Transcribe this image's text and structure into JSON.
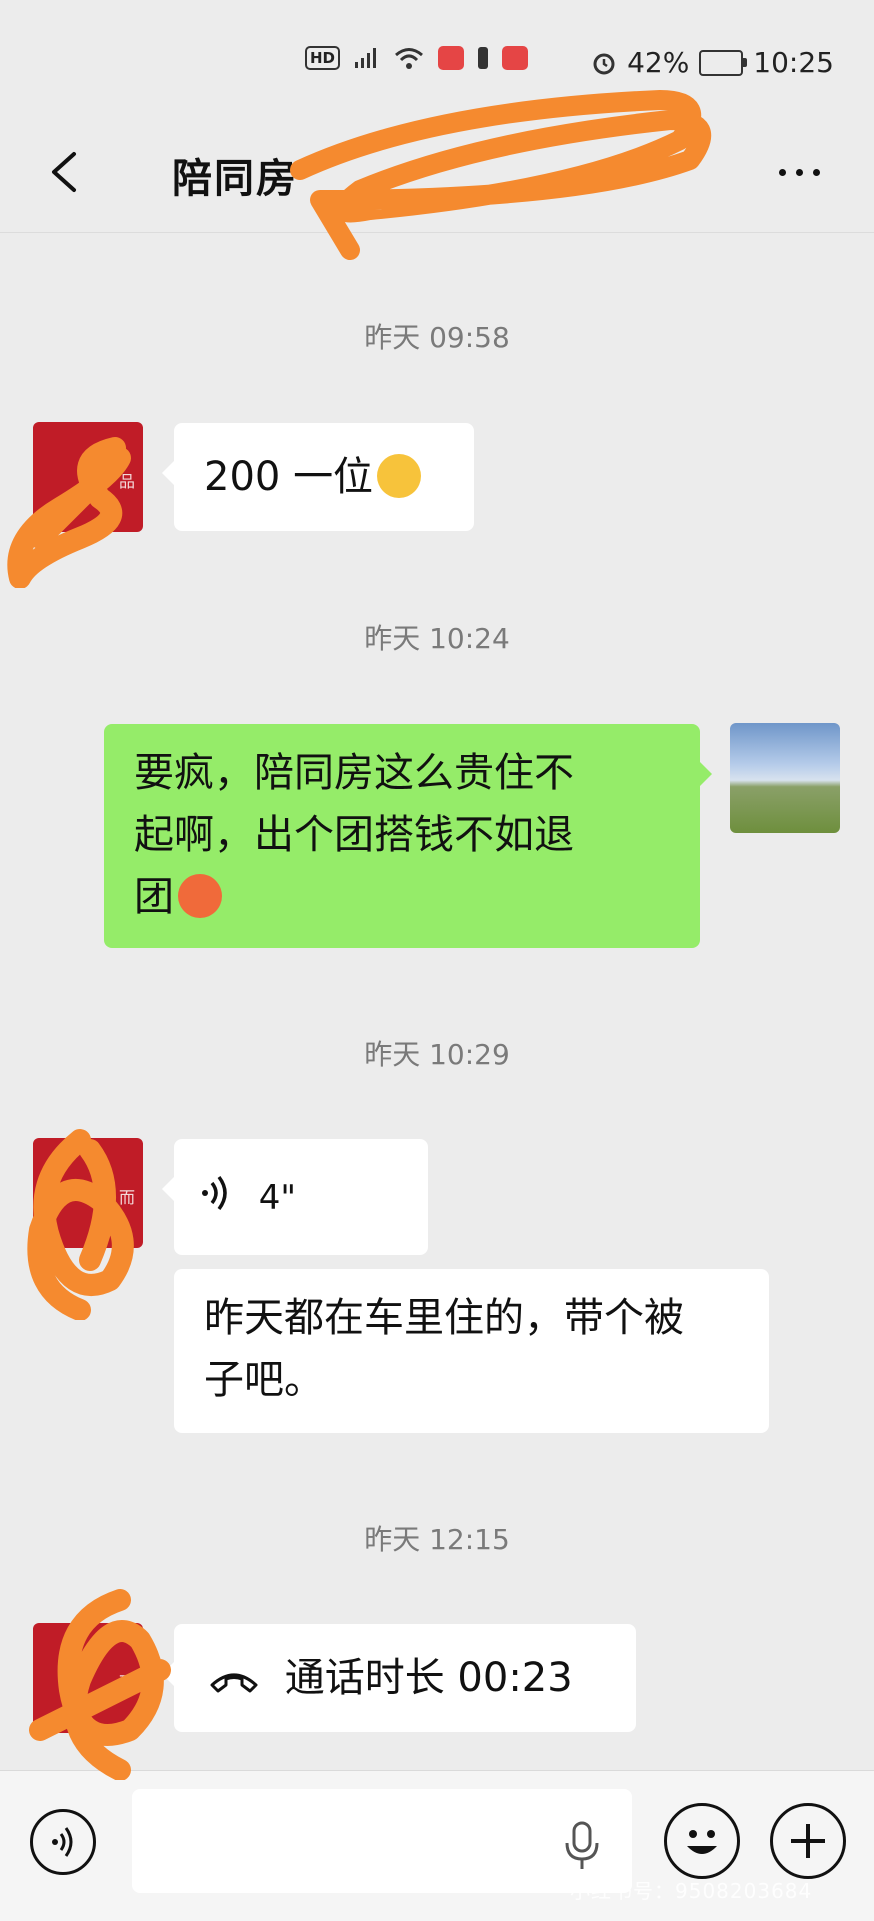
{
  "status_bar": {
    "hd": "HD",
    "battery_percent": "42%",
    "time": "10:25",
    "battery_level": 0.42
  },
  "header": {
    "title": "陪同房",
    "back_icon": "chevron-left-icon",
    "more_icon": "more-dots-icon"
  },
  "messages": [
    {
      "kind": "timestamp",
      "text": "昨天 09:58"
    },
    {
      "kind": "text",
      "side": "left",
      "text": "200 一位",
      "emoji": "loudly-crying-face"
    },
    {
      "kind": "timestamp",
      "text": "昨天 10:24"
    },
    {
      "kind": "text",
      "side": "right",
      "lines": [
        "要疯，陪同房这么贵住不",
        "起啊，出个团搭钱不如退",
        "团"
      ],
      "emoji": "angry-sweat-face"
    },
    {
      "kind": "timestamp",
      "text": "昨天 10:29"
    },
    {
      "kind": "voice",
      "side": "left",
      "duration": "4\""
    },
    {
      "kind": "text",
      "side": "left",
      "lines": [
        "昨天都在车里住的，带个被",
        "子吧。"
      ]
    },
    {
      "kind": "timestamp",
      "text": "昨天 12:15"
    },
    {
      "kind": "call",
      "side": "left",
      "text": "通话时长 00:23"
    }
  ],
  "input_bar": {
    "placeholder": "",
    "voice_icon": "voice-input-icon",
    "mic_icon": "microphone-icon",
    "emoji_icon": "emoji-face-icon",
    "plus_icon": "plus-icon"
  },
  "watermark": "小红书号：9508203684",
  "colors": {
    "background": "#ececec",
    "own_bubble": "#95ec69",
    "other_bubble": "#ffffff",
    "avatar": "#c01c27",
    "redaction": "#f58a2f"
  }
}
